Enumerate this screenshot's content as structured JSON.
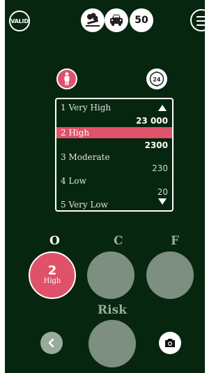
{
  "header": {
    "valid_label": "VALID",
    "icon_1": "fallen-tree-icon",
    "icon_2": "car-accident-icon",
    "counter": "50"
  },
  "selectors": {
    "person_icon": "person-icon",
    "timer_label": "24"
  },
  "scale": {
    "items": [
      {
        "label": "1 Very High",
        "value": "23 000"
      },
      {
        "label": "2 High",
        "value": "2300"
      },
      {
        "label": "3 Moderate",
        "value": "230"
      },
      {
        "label": "4 Low",
        "value": "20"
      },
      {
        "label": "5 Very Low",
        "value": ""
      }
    ],
    "selected_index": 1
  },
  "columns": {
    "o_label": "O",
    "c_label": "C",
    "f_label": "F",
    "o_value_number": "2",
    "o_value_text": "High"
  },
  "risk": {
    "label": "Risk"
  },
  "colors": {
    "background": "#07260f",
    "accent": "#e0526a",
    "circle": "#7d8f80"
  }
}
